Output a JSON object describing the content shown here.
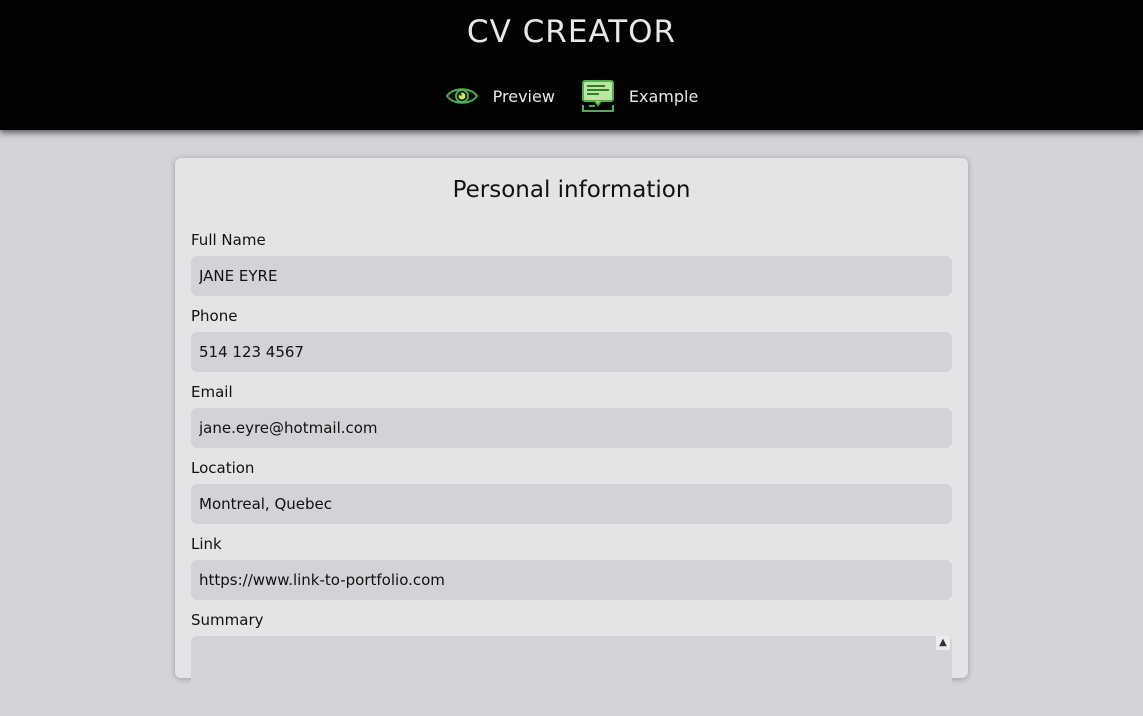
{
  "header": {
    "title": "CV CREATOR",
    "nav": [
      {
        "label": "Preview",
        "icon": "eye-icon"
      },
      {
        "label": "Example",
        "icon": "document-example-icon"
      }
    ],
    "accent_color": "#4caf50"
  },
  "form": {
    "title": "Personal information",
    "fields": [
      {
        "label": "Full Name",
        "value": "JANE EYRE"
      },
      {
        "label": "Phone",
        "value": "514 123 4567"
      },
      {
        "label": "Email",
        "value": "jane.eyre@hotmail.com"
      },
      {
        "label": "Location",
        "value": "Montreal, Quebec"
      },
      {
        "label": "Link",
        "value": "https://www.link-to-portfolio.com"
      },
      {
        "label": "Summary",
        "value": ""
      }
    ]
  }
}
